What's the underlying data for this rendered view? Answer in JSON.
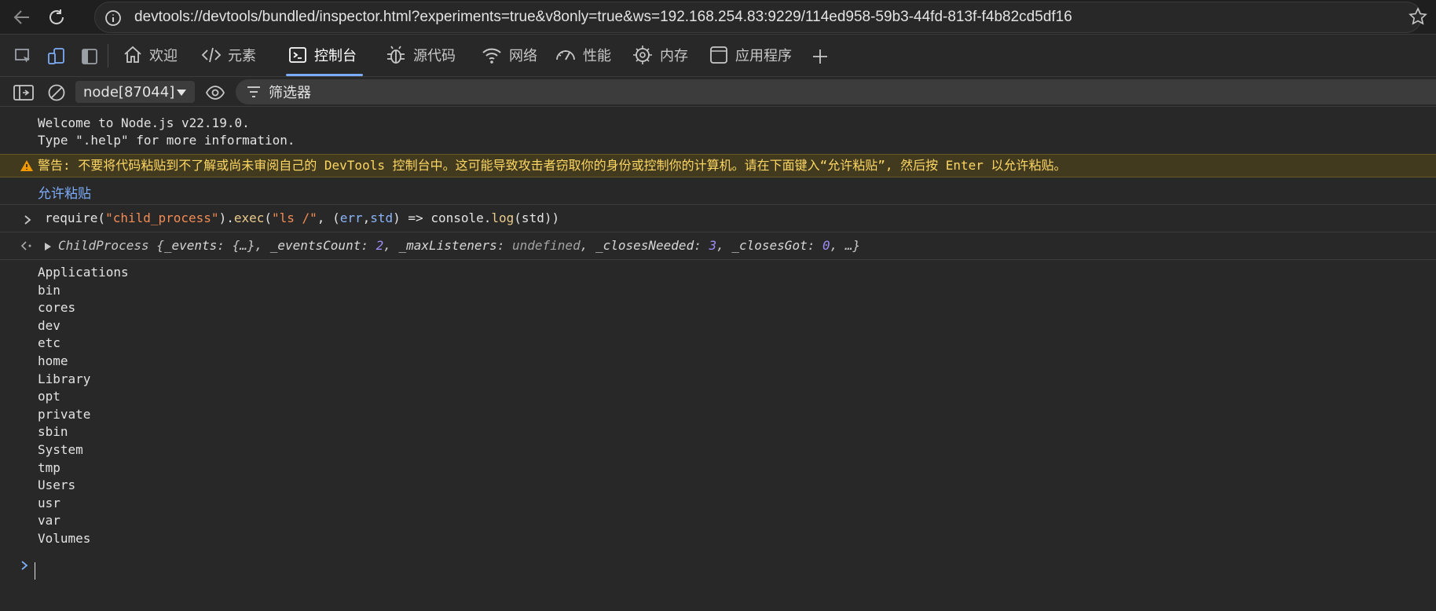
{
  "browser": {
    "url": "devtools://devtools/bundled/inspector.html?experiments=true&v8only=true&ws=192.168.254.83:9229/114ed958-59b3-44fd-813f-f4b82cd5df16"
  },
  "devtools": {
    "tabs": [
      {
        "label": "欢迎",
        "icon": "home-icon"
      },
      {
        "label": "元素",
        "icon": "code-icon"
      },
      {
        "label": "控制台",
        "icon": "console-icon",
        "active": true
      },
      {
        "label": "源代码",
        "icon": "bug-icon"
      },
      {
        "label": "网络",
        "icon": "wifi-icon"
      },
      {
        "label": "性能",
        "icon": "gauge-icon"
      },
      {
        "label": "内存",
        "icon": "chip-icon"
      },
      {
        "label": "应用程序",
        "icon": "app-icon"
      }
    ],
    "accent_color": "#7cacf8"
  },
  "console_toolbar": {
    "context": "node[87044]",
    "filter_label": "筛选器"
  },
  "console": {
    "welcome_line1": "Welcome to Node.js v22.19.0.",
    "welcome_line2": "Type \".help\" for more information.",
    "warning": "警告: 不要将代码粘贴到不了解或尚未审阅自己的 DevTools 控制台中。这可能导致攻击者窃取你的身份或控制你的计算机。请在下面键入“允许粘贴”, 然后按 Enter 以允许粘贴。",
    "allow_paste": "允许粘贴",
    "input": {
      "t1": "require(",
      "t2": "\"child_process\"",
      "t3": ").",
      "t4": "exec",
      "t5": "(",
      "t6": "\"ls /\"",
      "t7": ", (",
      "t8": "err",
      "t9": ",",
      "t10": "std",
      "t11": ") => console.",
      "t12": "log",
      "t13": "(std))"
    },
    "result": {
      "class_name": "ChildProcess",
      "p1": " {",
      "k1": "_events",
      "v1": ": {…}, ",
      "k2": "_eventsCount",
      "v2sep": ": ",
      "v2": "2",
      "c2": ", ",
      "k3": "_maxListeners",
      "v3sep": ": ",
      "v3": "undefined",
      "c3": ", ",
      "k4": "_closesNeeded",
      "v4sep": ": ",
      "v4": "3",
      "c4": ", ",
      "k5": "_closesGot",
      "v5sep": ": ",
      "v5": "0",
      "tail": ", …}"
    },
    "output_lines": [
      "Applications",
      "bin",
      "cores",
      "dev",
      "etc",
      "home",
      "Library",
      "opt",
      "private",
      "sbin",
      "System",
      "tmp",
      "Users",
      "usr",
      "var",
      "Volumes"
    ]
  }
}
